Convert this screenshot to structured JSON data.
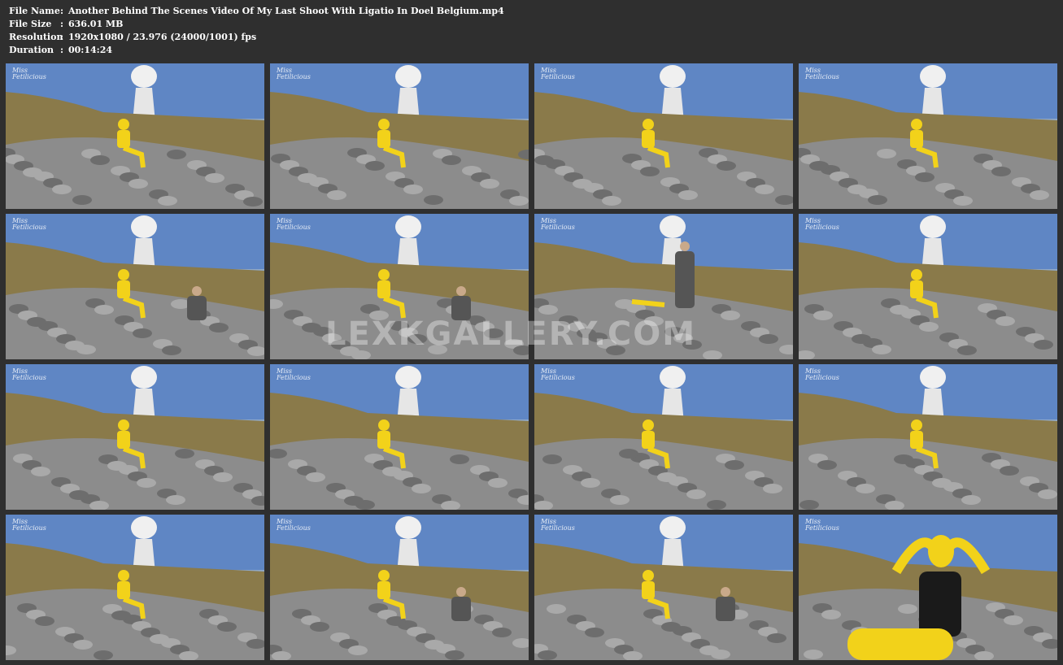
{
  "info": {
    "separator": ":",
    "rows": [
      {
        "label": "File Name",
        "value": "Another Behind The Scenes Video Of My Last Shoot With Ligatio In Doel Belgium.mp4"
      },
      {
        "label": "File Size",
        "value": "636.01 MB"
      },
      {
        "label": "Resolution",
        "value": "1920x1080 / 23.976 (24000/1001) fps"
      },
      {
        "label": "Duration",
        "value": "00:14:24"
      }
    ]
  },
  "watermark_text": "LEXKGALLERY.COM",
  "thumb_logo": "Miss Fetilicious",
  "colors": {
    "background": "#2f2f2f",
    "sky": "#5f86c4",
    "grass": "#8a7a4a",
    "rocks": "#8c8c8c",
    "suit": "#f2d21a"
  },
  "thumbnails": [
    {
      "scene": "model-sitting-rocks"
    },
    {
      "scene": "model-sitting-rocks"
    },
    {
      "scene": "model-sitting-rocks"
    },
    {
      "scene": "model-sitting-rocks"
    },
    {
      "scene": "model-with-photographer"
    },
    {
      "scene": "model-with-photographer"
    },
    {
      "scene": "photographer-standing"
    },
    {
      "scene": "model-sitting-rocks"
    },
    {
      "scene": "model-sitting-rocks"
    },
    {
      "scene": "model-sitting-rocks"
    },
    {
      "scene": "model-sitting-rocks"
    },
    {
      "scene": "model-sitting-rocks"
    },
    {
      "scene": "model-sitting-rocks"
    },
    {
      "scene": "model-with-photographer"
    },
    {
      "scene": "model-with-photographer"
    },
    {
      "scene": "model-closeup"
    }
  ]
}
